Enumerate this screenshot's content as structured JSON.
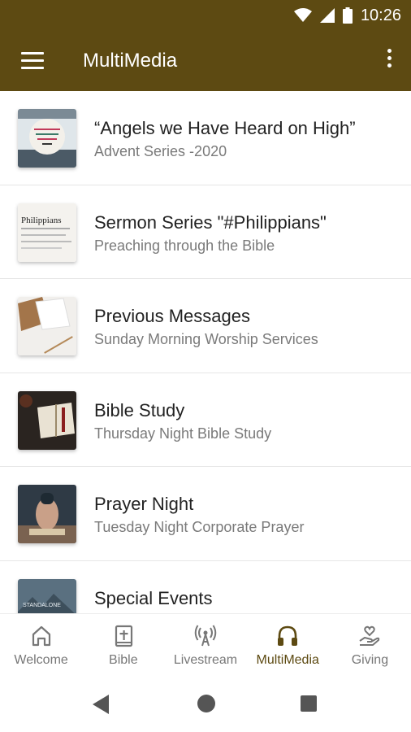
{
  "status_bar": {
    "time": "10:26"
  },
  "app_bar": {
    "title": "MultiMedia"
  },
  "items": [
    {
      "title": "“Angels we Have Heard on High”",
      "subtitle": "Advent Series -2020"
    },
    {
      "title": "Sermon Series \"#Philippians\"",
      "subtitle": "Preaching through the Bible"
    },
    {
      "title": "Previous Messages",
      "subtitle": "Sunday Morning Worship Services"
    },
    {
      "title": "Bible Study",
      "subtitle": "Thursday Night Bible Study"
    },
    {
      "title": "Prayer Night",
      "subtitle": "Tuesday Night Corporate Prayer"
    },
    {
      "title": "Special Events",
      "subtitle": ""
    }
  ],
  "thumb_texts": {
    "philippians": "Philippians",
    "standalone": "STANDALONE"
  },
  "bottom_nav": [
    {
      "label": "Welcome",
      "icon": "home-icon",
      "active": false
    },
    {
      "label": "Bible",
      "icon": "bible-icon",
      "active": false
    },
    {
      "label": "Livestream",
      "icon": "broadcast-icon",
      "active": false
    },
    {
      "label": "MultiMedia",
      "icon": "headphones-icon",
      "active": true
    },
    {
      "label": "Giving",
      "icon": "giving-hand-icon",
      "active": false
    }
  ],
  "colors": {
    "brand": "#5d4a12",
    "inactive": "#777777"
  }
}
